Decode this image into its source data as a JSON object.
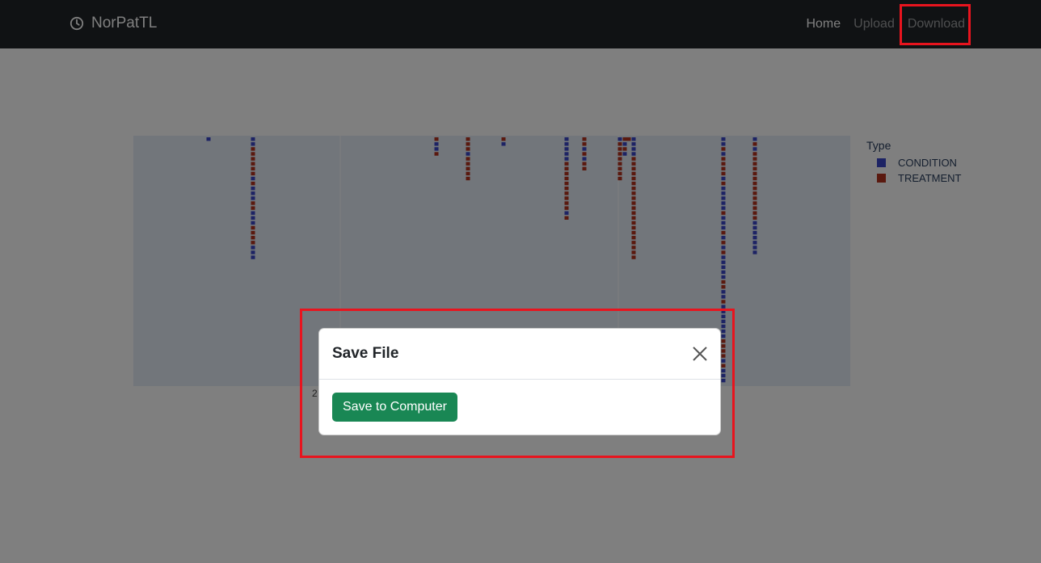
{
  "navbar": {
    "brand": "NorPatTL",
    "brand_icon": "clock-icon",
    "links": [
      {
        "label": "Home",
        "active": true
      },
      {
        "label": "Upload",
        "active": false
      },
      {
        "label": "Download",
        "active": false
      }
    ]
  },
  "chart": {
    "legend_title": "Type",
    "legend_items": [
      {
        "label": "CONDITION",
        "color": "#3b46c9"
      },
      {
        "label": "TREATMENT",
        "color": "#b5321f"
      }
    ],
    "x_tick_partial": "2"
  },
  "chart_data": {
    "type": "scatter",
    "legend": "top-right",
    "series": [
      {
        "name": "CONDITION",
        "color": "#3b46c9"
      },
      {
        "name": "TREATMENT",
        "color": "#b5321f"
      }
    ]
  },
  "modal": {
    "title": "Save File",
    "close_icon": "close-icon",
    "save_button": "Save to Computer"
  },
  "colors": {
    "navbar_bg": "#212529",
    "save_green": "#198754",
    "highlight_red": "#e8141e"
  }
}
